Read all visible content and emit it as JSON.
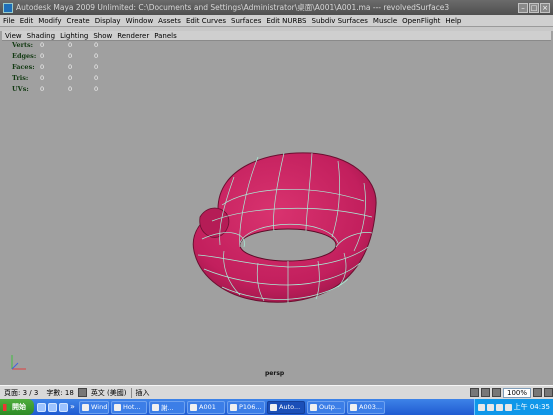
{
  "window": {
    "title": "Autodesk Maya 2009 Unlimited: C:\\Documents and Settings\\Administrator\\桌面\\A001\\A001.ma   ---   revolvedSurface3"
  },
  "menubar": [
    "File",
    "Edit",
    "Modify",
    "Create",
    "Display",
    "Window",
    "Assets",
    "Edit Curves",
    "Surfaces",
    "Edit NURBS",
    "Subdiv Surfaces",
    "Muscle",
    "OpenFlight",
    "Help"
  ],
  "panel_menu": [
    "View",
    "Shading",
    "Lighting",
    "Show",
    "Renderer",
    "Panels"
  ],
  "hud": [
    {
      "label": "Verts:",
      "v1": "0",
      "v2": "0",
      "v3": "0"
    },
    {
      "label": "Edges:",
      "v1": "0",
      "v2": "0",
      "v3": "0"
    },
    {
      "label": "Faces:",
      "v1": "0",
      "v2": "0",
      "v3": "0"
    },
    {
      "label": "Tris:",
      "v1": "0",
      "v2": "0",
      "v3": "0"
    },
    {
      "label": "UVs:",
      "v1": "0",
      "v2": "0",
      "v3": "0"
    }
  ],
  "viewport": {
    "camera": "persp",
    "model_color": "#c92463",
    "wire_color": "#a8f0d8",
    "background": "#a0a0a0"
  },
  "statusline": {
    "page": "頁面: 3 / 3",
    "words": "字數: 18",
    "language": "英文 (美國)",
    "mode": "插入",
    "zoom": "100%"
  },
  "taskbar": {
    "start": "開始",
    "quick_more": "»",
    "tasks": [
      {
        "label": "Wind..."
      },
      {
        "label": "Hot..."
      },
      {
        "label": "謝..."
      },
      {
        "label": "A001"
      },
      {
        "label": "P106..."
      },
      {
        "label": "Auto..."
      },
      {
        "label": "Outp..."
      },
      {
        "label": "A003..."
      }
    ],
    "clock": "上午 04:35"
  }
}
